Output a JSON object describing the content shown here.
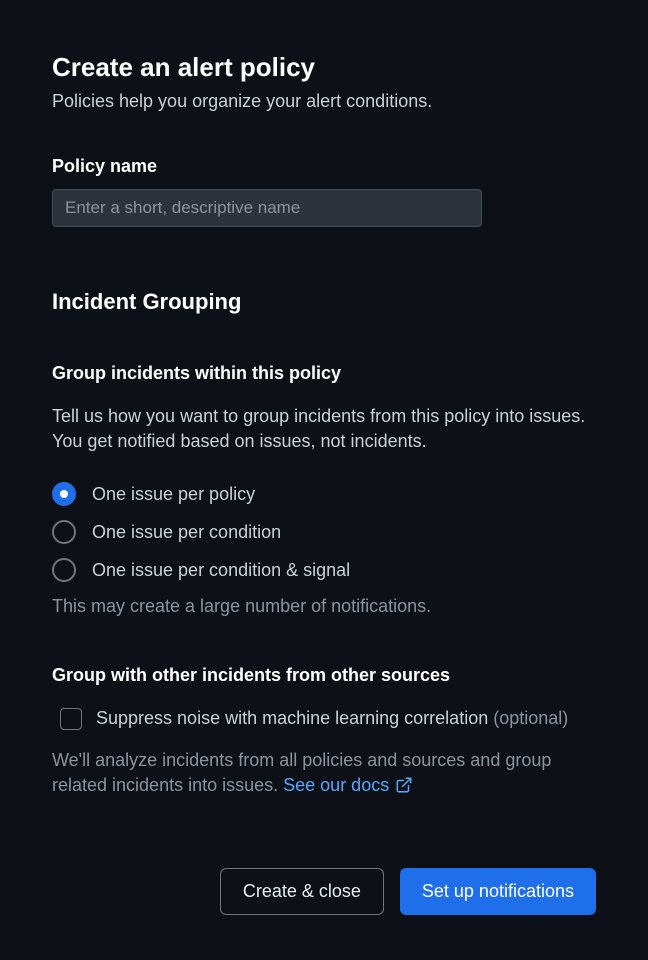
{
  "header": {
    "title": "Create an alert policy",
    "subtitle": "Policies help you organize your alert conditions."
  },
  "policy_name": {
    "label": "Policy name",
    "placeholder": "Enter a short, descriptive name",
    "value": ""
  },
  "incident_grouping": {
    "title": "Incident Grouping",
    "within_policy": {
      "title": "Group incidents within this policy",
      "description": "Tell us how you want to group incidents from this policy into issues. You get notified based on issues, not incidents.",
      "options": [
        {
          "label": "One issue per policy",
          "selected": true
        },
        {
          "label": "One issue per condition",
          "selected": false
        },
        {
          "label": "One issue per condition & signal",
          "selected": false
        }
      ],
      "helper": "This may create a large number of notifications."
    },
    "other_sources": {
      "title": "Group with other incidents from other sources",
      "checkbox_label": "Suppress noise with machine learning correlation",
      "checkbox_optional": "(optional)",
      "checkbox_checked": false,
      "description": "We'll analyze incidents from all policies and sources and group related incidents into issues. ",
      "link_text": "See our docs"
    }
  },
  "buttons": {
    "create_close": "Create & close",
    "setup_notifications": "Set up notifications"
  }
}
